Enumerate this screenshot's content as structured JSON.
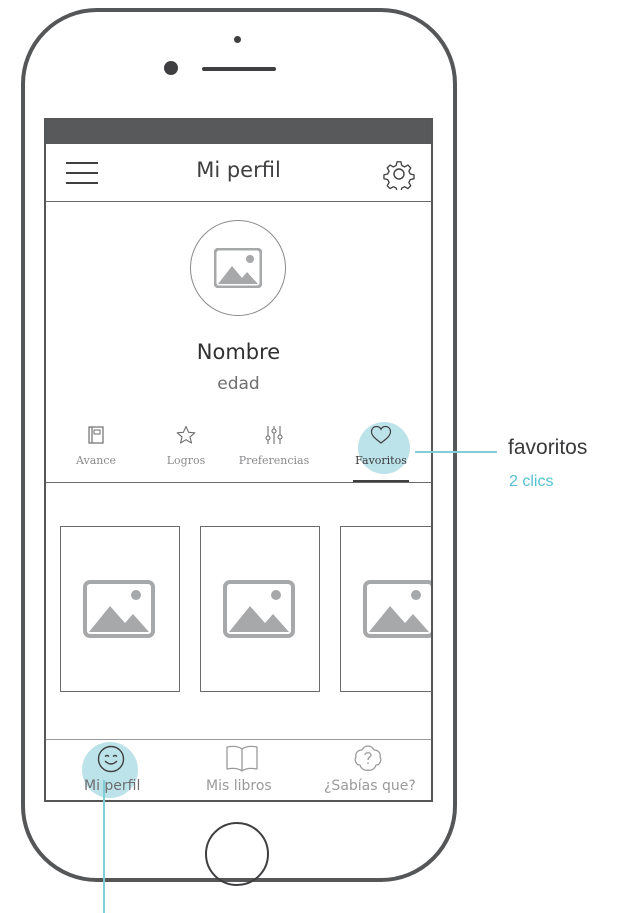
{
  "header": {
    "title": "Mi perfil"
  },
  "profile": {
    "name": "Nombre",
    "age": "edad"
  },
  "tabs": [
    {
      "label": "Avance",
      "icon": "book-icon"
    },
    {
      "label": "Logros",
      "icon": "star-icon"
    },
    {
      "label": "Preferencias",
      "icon": "sliders-icon"
    },
    {
      "label": "Favoritos",
      "icon": "heart-icon",
      "active": true
    }
  ],
  "favorites": [
    {
      "image": "image-placeholder-icon"
    },
    {
      "image": "image-placeholder-icon"
    },
    {
      "image": "image-placeholder-icon"
    }
  ],
  "bottom_nav": [
    {
      "label": "Mi perfil",
      "icon": "smile-icon",
      "active": true
    },
    {
      "label": "Mis libros",
      "icon": "open-book-icon"
    },
    {
      "label": "¿Sabías que?",
      "icon": "question-cloud-icon"
    }
  ],
  "annotation": {
    "title": "favoritos",
    "subtitle": "2 clics"
  },
  "colors": {
    "accent": "#7fcfdb",
    "highlight": "#b6e0e8",
    "frame": "#555658",
    "status_bar": "#58595b"
  }
}
